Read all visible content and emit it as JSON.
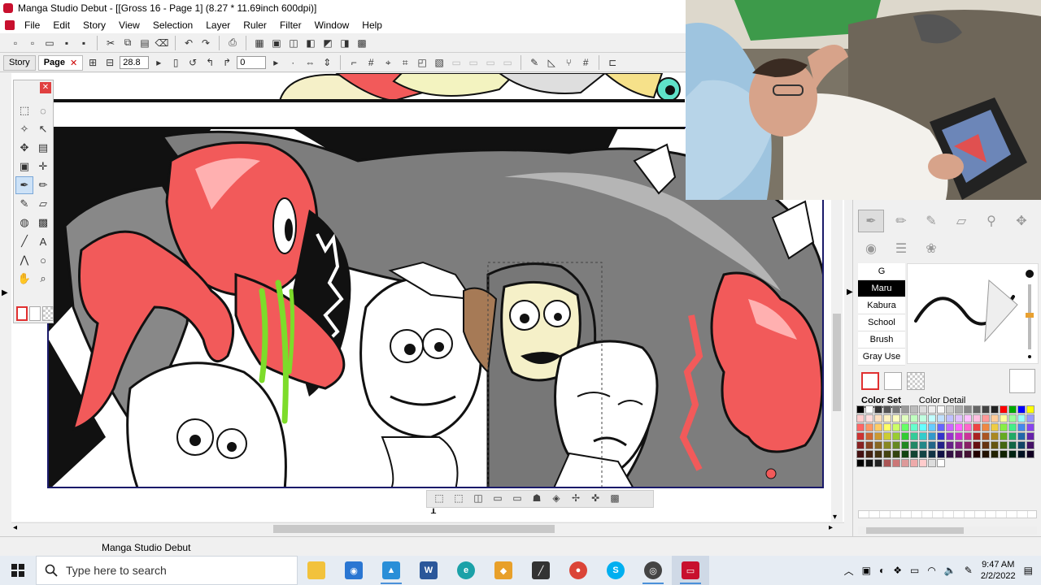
{
  "window": {
    "title": "Manga Studio Debut - [[Gross 16 - Page 1] (8.27 * 11.69inch 600dpi)]"
  },
  "menu": [
    "File",
    "Edit",
    "Story",
    "View",
    "Selection",
    "Layer",
    "Ruler",
    "Filter",
    "Window",
    "Help"
  ],
  "tabs": [
    {
      "label": "Story"
    },
    {
      "label": "Page",
      "close": "✕"
    }
  ],
  "toolbar2": {
    "zoom": "28.8",
    "angle": "0"
  },
  "brush_list": [
    "G",
    "Maru",
    "Kabura",
    "School",
    "Brush",
    "Gray Use"
  ],
  "brush_selected": "Maru",
  "color_tabs": [
    "Color Set",
    "Color Detail"
  ],
  "status": {
    "app_name": "Manga Studio Debut"
  },
  "taskbar": {
    "search_placeholder": "Type here to search",
    "time": "9:47 AM",
    "date": "2/2/2022"
  },
  "colors": {
    "accent": "#c8102e",
    "taskbar": "#e6ecf3",
    "canvas_border": "#1a1a6a",
    "skin_red": "#f25a5a",
    "drool": "#7ddc2a"
  },
  "icons": {
    "start": "windows-logo-icon",
    "search": "search-icon"
  }
}
